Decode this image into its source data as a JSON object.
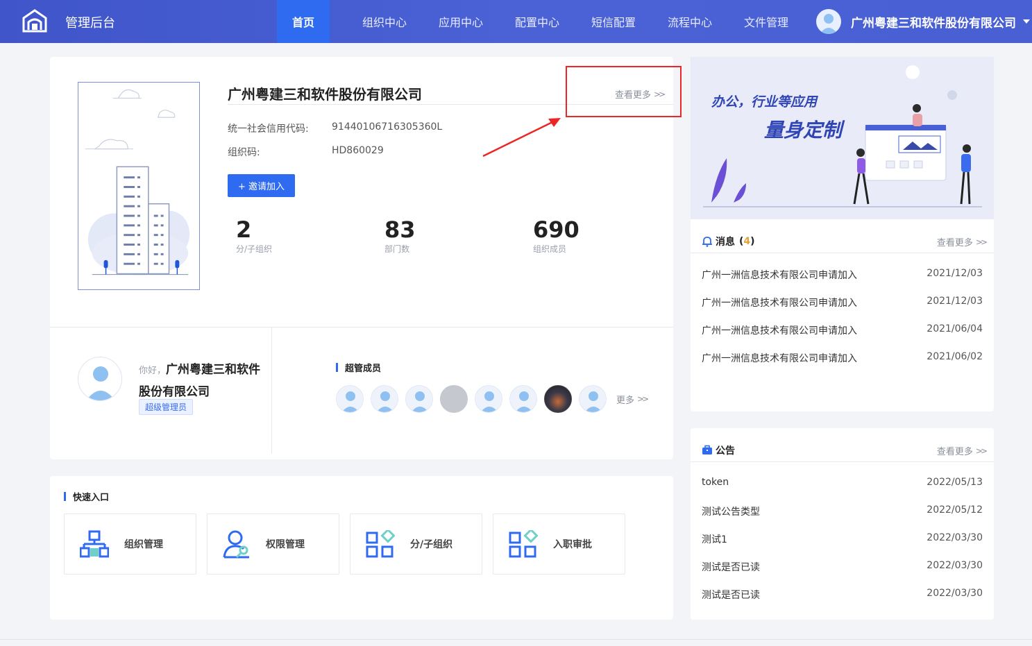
{
  "header": {
    "app_title": "管理后台",
    "nav": [
      "首页",
      "组织中心",
      "应用中心",
      "配置中心",
      "短信配置",
      "流程中心",
      "文件管理"
    ],
    "active_nav": "首页",
    "user_name": "广州粤建三和软件股份有限公司"
  },
  "org": {
    "name": "广州粤建三和软件股份有限公司",
    "more": "查看更多",
    "credit_code_label": "统一社会信用代码:",
    "credit_code": "91440106716305360L",
    "org_code_label": "组织码:",
    "org_code": "HD860029",
    "invite_label": "+ 邀请加入",
    "stats": [
      {
        "value": "2",
        "label": "分/子组织"
      },
      {
        "value": "83",
        "label": "部门数"
      },
      {
        "value": "690",
        "label": "组织成员"
      }
    ]
  },
  "profile": {
    "hello": "你好，",
    "name": "广州粤建三和软件股份有限公司",
    "role": "超级管理员"
  },
  "super_members": {
    "title": "超管成员",
    "more": "更多"
  },
  "quick_entry": {
    "title": "快速入口",
    "items": [
      "组织管理",
      "权限管理",
      "分/子组织",
      "入职审批"
    ]
  },
  "banner": {
    "line1": "办公，行业等应用",
    "line2": "量身定制"
  },
  "messages": {
    "title": "消息",
    "count": "4",
    "more": "查看更多",
    "items": [
      {
        "title": "广州一洲信息技术有限公司申请加入",
        "date": "2021/12/03"
      },
      {
        "title": "广州一洲信息技术有限公司申请加入",
        "date": "2021/12/03"
      },
      {
        "title": "广州一洲信息技术有限公司申请加入",
        "date": "2021/06/04"
      },
      {
        "title": "广州一洲信息技术有限公司申请加入",
        "date": "2021/06/02"
      }
    ]
  },
  "notices": {
    "title": "公告",
    "more": "查看更多",
    "items": [
      {
        "title": "token",
        "date": "2022/05/13"
      },
      {
        "title": "测试公告类型",
        "date": "2022/05/12"
      },
      {
        "title": "测试1",
        "date": "2022/03/30"
      },
      {
        "title": "测试是否已读",
        "date": "2022/03/30"
      },
      {
        "title": "测试是否已读",
        "date": "2022/03/30"
      }
    ]
  },
  "colors": {
    "primary": "#2f6bf0",
    "header": "#4a62d6",
    "annotation": "#ec2626"
  }
}
